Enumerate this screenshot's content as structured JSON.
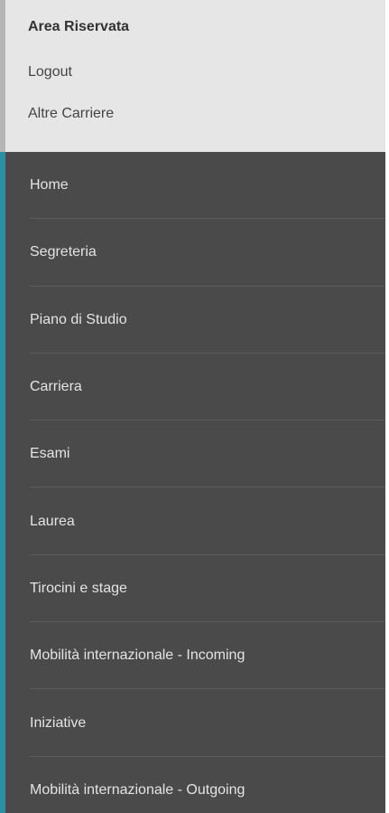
{
  "account_panel": {
    "title": "Area Riservata",
    "logout_label": "Logout",
    "altre_carriere_label": "Altre Carriere"
  },
  "menu": {
    "items": [
      {
        "label": "Home"
      },
      {
        "label": "Segreteria"
      },
      {
        "label": "Piano di Studio"
      },
      {
        "label": "Carriera"
      },
      {
        "label": "Esami"
      },
      {
        "label": "Laurea"
      },
      {
        "label": "Tirocini e stage"
      },
      {
        "label": "Mobilità internazionale - Incoming"
      },
      {
        "label": "Iniziative"
      },
      {
        "label": "Mobilità internazionale - Outgoing"
      }
    ]
  },
  "colors": {
    "accent": "#2a8fa5",
    "menu_background": "#4a4a4a",
    "panel_background": "#e6e6e6"
  }
}
